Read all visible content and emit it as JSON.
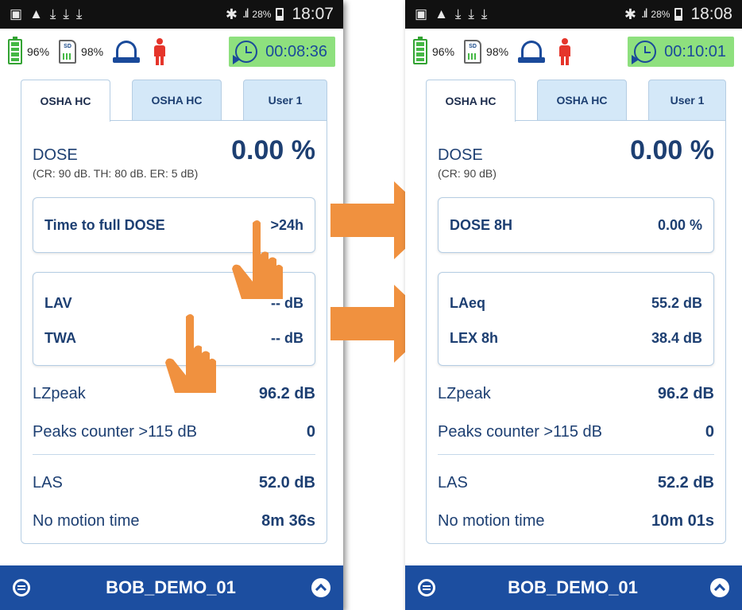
{
  "colors": {
    "primary": "#1d3f72",
    "bottombar": "#1c4ea0",
    "timer_bg": "#8ee07e",
    "tab_bg": "#d4e8f8",
    "arrow": "#f0913f",
    "battery_green": "#45b845",
    "person_red": "#e5352b"
  },
  "left": {
    "status": {
      "signal_pct": "28%",
      "time": "18:07"
    },
    "info": {
      "battery": "96%",
      "sd": "98%",
      "timer": "00:08:36",
      "sd_label": "SD"
    },
    "tabs": [
      "OSHA HC",
      "OSHA HC",
      "User 1"
    ],
    "dose": {
      "label": "DOSE",
      "sub": "(CR: 90 dB. TH: 80 dB. ER: 5 dB)",
      "value": "0.00 %"
    },
    "box1": {
      "label": "Time to full DOSE",
      "value": ">24h"
    },
    "box2": [
      {
        "label": "LAV",
        "value": "-- dB"
      },
      {
        "label": "TWA",
        "value": "-- dB"
      }
    ],
    "lines": [
      {
        "label": "LZpeak",
        "value": "96.2 dB"
      },
      {
        "label": "Peaks counter >115 dB",
        "value": "0"
      },
      {
        "label": "LAS",
        "value": "52.0 dB"
      },
      {
        "label": "No motion time",
        "value": "8m 36s"
      }
    ],
    "device": "BOB_DEMO_01"
  },
  "right": {
    "status": {
      "signal_pct": "28%",
      "time": "18:08"
    },
    "info": {
      "battery": "96%",
      "sd": "98%",
      "timer": "00:10:01",
      "sd_label": "SD"
    },
    "tabs": [
      "OSHA HC",
      "OSHA HC",
      "User 1"
    ],
    "dose": {
      "label": "DOSE",
      "sub": "(CR: 90 dB)",
      "value": "0.00 %"
    },
    "box1": {
      "label": "DOSE 8H",
      "value": "0.00 %"
    },
    "box2": [
      {
        "label": "LAeq",
        "value": "55.2 dB"
      },
      {
        "label": "LEX 8h",
        "value": "38.4 dB"
      }
    ],
    "lines": [
      {
        "label": "LZpeak",
        "value": "96.2 dB"
      },
      {
        "label": "Peaks counter >115 dB",
        "value": "0"
      },
      {
        "label": "LAS",
        "value": "52.2 dB"
      },
      {
        "label": "No motion time",
        "value": "10m 01s"
      }
    ],
    "device": "BOB_DEMO_01"
  }
}
